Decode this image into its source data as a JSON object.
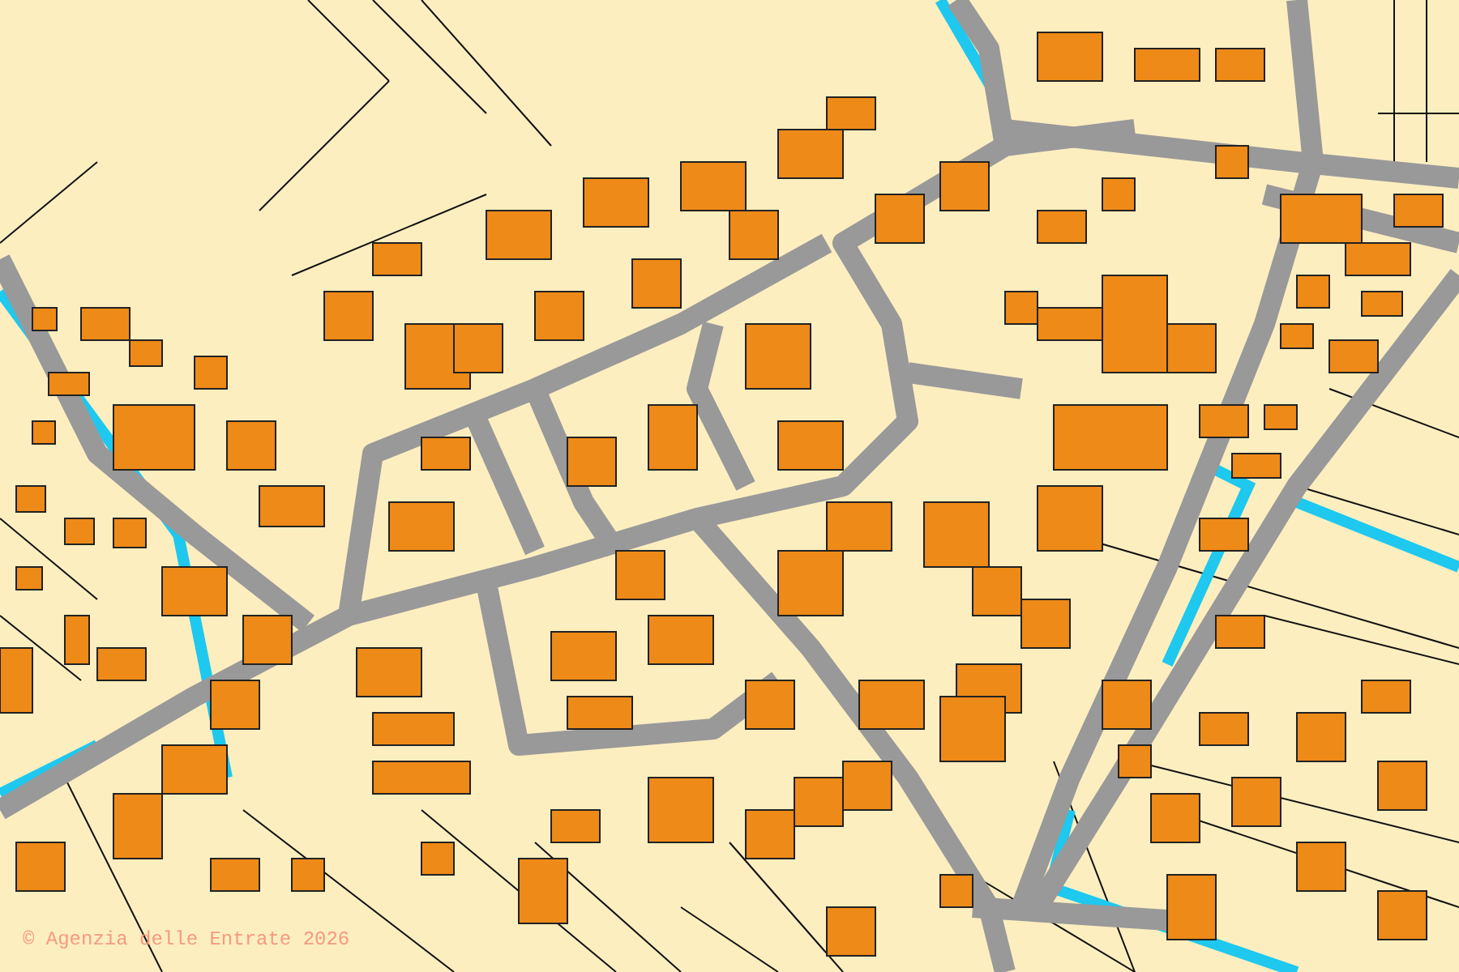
{
  "map": {
    "attribution": "© Agenzia delle Entrate 2026"
  }
}
